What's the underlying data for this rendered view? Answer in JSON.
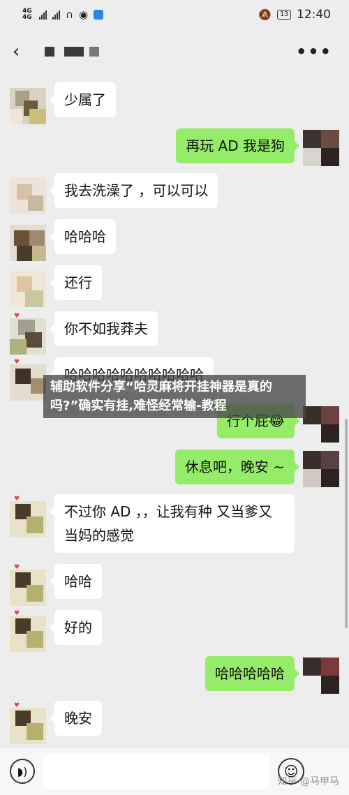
{
  "status_bar": {
    "network": "4G",
    "network_sub": "4G",
    "time": "12:40",
    "battery": "13"
  },
  "header": {
    "back_icon": "chevron-left-icon",
    "menu_icon": "more-icon",
    "menu_glyph": "•••"
  },
  "messages": [
    {
      "side": "left",
      "text": "少属了"
    },
    {
      "side": "right",
      "text": "再玩 AD 我是狗"
    },
    {
      "side": "left",
      "text": "我去洗澡了 ，可以可以"
    },
    {
      "side": "left",
      "text": "哈哈哈"
    },
    {
      "side": "left",
      "text": "还行"
    },
    {
      "side": "left",
      "text": "你不如我莽夫"
    },
    {
      "side": "left",
      "text": "哈哈哈哈哈哈哈哈哈哈"
    },
    {
      "side": "right",
      "text": "行个屁"
    },
    {
      "side": "right",
      "text": "休息吧，晚安 ~"
    },
    {
      "side": "left",
      "text": "不过你 AD ，，让我有种 又当爹又当妈的感觉"
    },
    {
      "side": "left",
      "text": "哈哈"
    },
    {
      "side": "left",
      "text": "好的"
    },
    {
      "side": "right",
      "text": "哈哈哈哈哈"
    },
    {
      "side": "left",
      "text": "晚安"
    }
  ],
  "banner": {
    "text": "辅助软件分享“哈灵麻将开挂神器是真的吗?”确实有挂,难怪经常输-教程"
  },
  "input_bar": {
    "voice_icon": "voice-icon",
    "emoji_icon": "emoji-icon",
    "input_value": "",
    "watermark": "知乎 @马甲马"
  },
  "colors": {
    "background": "#ededed",
    "bubble_right": "#95ec69",
    "bubble_left": "#ffffff"
  }
}
